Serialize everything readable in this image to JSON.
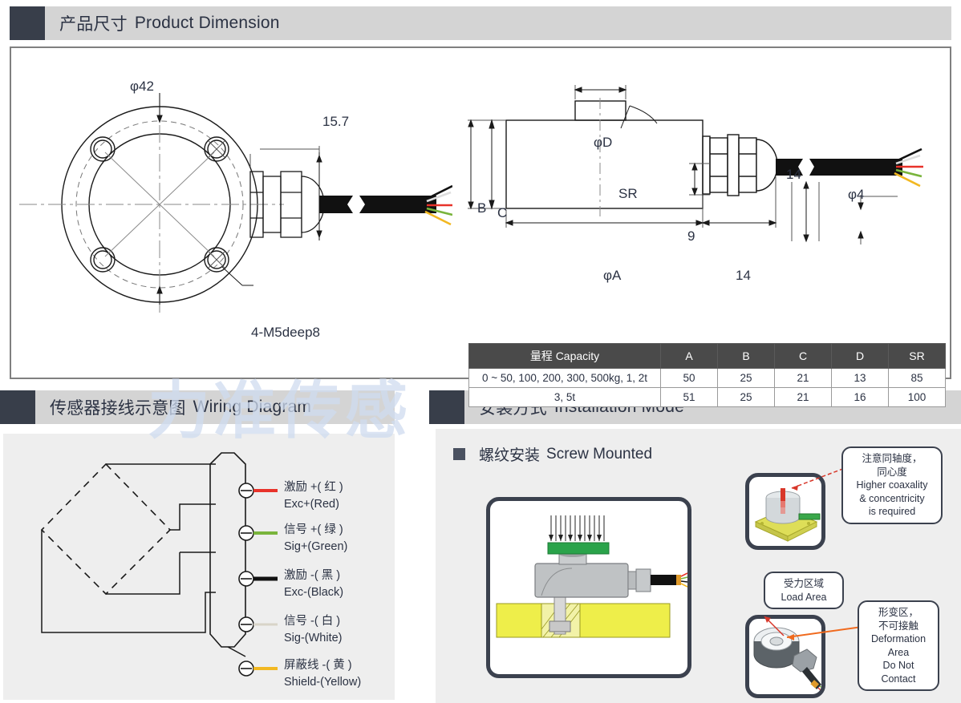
{
  "sections": {
    "dimension": {
      "cn": "产品尺寸",
      "en": "Product Dimension"
    },
    "wiring": {
      "cn": "传感器接线示意图",
      "en": "Wiring Diagram"
    },
    "install": {
      "cn": "安装方式",
      "en": "Installation Mode"
    }
  },
  "watermark": "力准传感",
  "drawing": {
    "front": {
      "dia_outer": "φ42",
      "cable_gland": "15.7",
      "thread_note": "4-M5deep8"
    },
    "side": {
      "dia_d": "φD",
      "sr": "SR",
      "height_b": "B",
      "height_c": "C",
      "gland_h": "9",
      "dia_a": "φA",
      "gland_len": "14",
      "gland_len2": "14",
      "cable_dia": "φ4"
    }
  },
  "spec_table": {
    "headers": [
      "量程 Capacity",
      "A",
      "B",
      "C",
      "D",
      "SR"
    ],
    "rows": [
      [
        "0 ~ 50, 100, 200, 300, 500kg, 1, 2t",
        "50",
        "25",
        "21",
        "13",
        "85"
      ],
      [
        "3, 5t",
        "51",
        "25",
        "21",
        "16",
        "100"
      ]
    ]
  },
  "wiring": {
    "leads": [
      {
        "cn": "激励 +( 红 )",
        "en": "Exc+(Red)",
        "color": "#e8322a"
      },
      {
        "cn": "信号 +( 绿 )",
        "en": "Sig+(Green)",
        "color": "#79b43c"
      },
      {
        "cn": "激励 -( 黑 )",
        "en": "Exc-(Black)",
        "color": "#111111"
      },
      {
        "cn": "信号 -( 白 )",
        "en": "Sig-(White)",
        "color": "#ffffff"
      },
      {
        "cn": "屏蔽线 -( 黄 )",
        "en": "Shield-(Yellow)",
        "color": "#f2b822"
      }
    ]
  },
  "install": {
    "mode": {
      "cn": "螺纹安装",
      "en": "Screw Mounted"
    },
    "callouts": [
      {
        "id": "coaxiality",
        "lines": [
          "注意同轴度，",
          "同心度",
          "Higher coaxality",
          "& concentricity",
          "is required"
        ]
      },
      {
        "id": "load-area",
        "lines": [
          "受力区域",
          "Load Area"
        ]
      },
      {
        "id": "deformation",
        "lines": [
          "形变区，",
          "不可接触",
          "Deformation",
          "Area",
          "Do Not",
          "Contact"
        ]
      }
    ]
  },
  "colors": {
    "tab": "#383e4a",
    "headerbar": "#d4d4d4",
    "panel_border": "#808080",
    "panel_gray": "#eeeeee",
    "table_header": "#4a4a4a",
    "watermark": "#cfdcf0"
  }
}
